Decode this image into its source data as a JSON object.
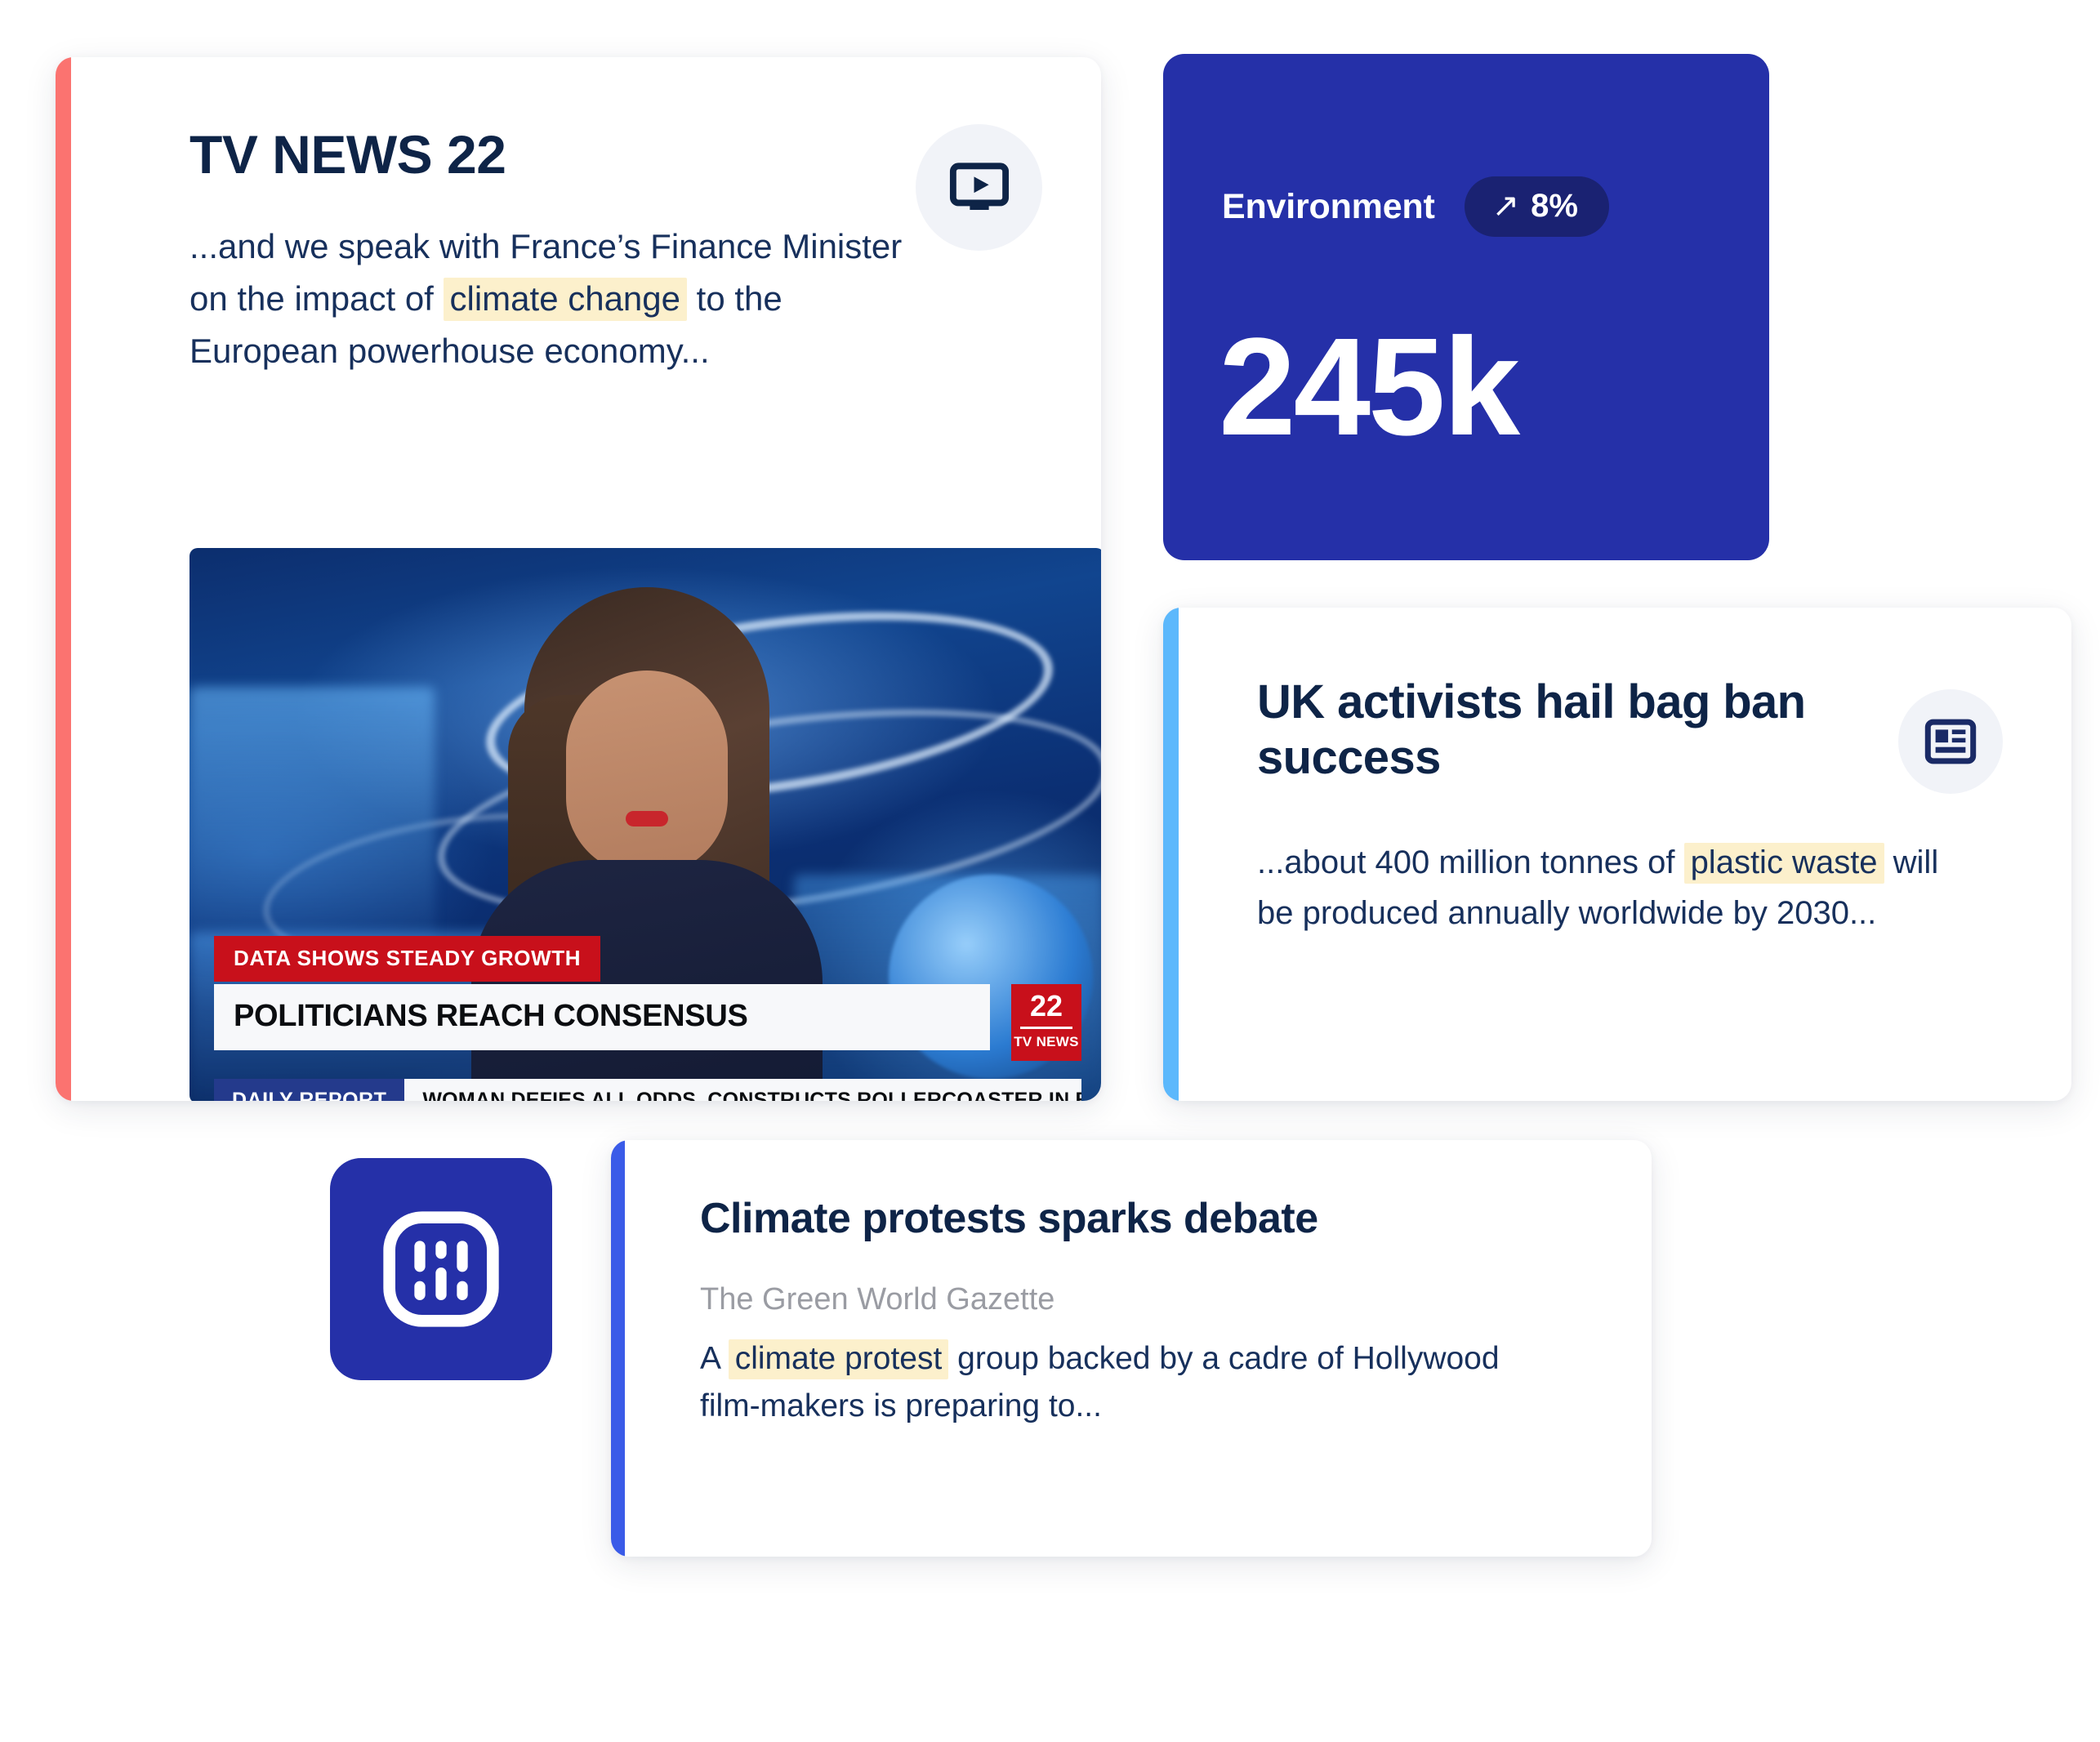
{
  "cards": {
    "tv_news": {
      "title": "TV NEWS 22",
      "snippet_part1": "...and we speak with France’s Finance Minister on the impact of ",
      "snippet_highlight": "climate change",
      "snippet_part2": " to the European powerhouse economy...",
      "icon": "tv-play-icon",
      "accent_color": "#FB7370",
      "broadcast": {
        "kicker": "DATA SHOWS STEADY GROWTH",
        "headline": "POLITICIANS REACH CONSENSUS",
        "logo_number": "22",
        "logo_caption": "TV NEWS",
        "ticker_tag": "DAILY REPORT",
        "ticker_text": "WOMAN DEFIES ALL ODDS, CONSTRUCTS ROLLERCOASTER IN BACKYARD"
      }
    },
    "stat": {
      "label": "Environment",
      "trend_arrow": "↗",
      "trend_value": "8%",
      "value": "245k",
      "background_color": "#2530A8",
      "badge_color": "#1A2272"
    },
    "uk_activists": {
      "title": "UK activists hail bag ban success",
      "snippet_part1": "...about 400 million tonnes of ",
      "snippet_highlight": "plastic waste",
      "snippet_part2": " will be produced annually worldwide by 2030...",
      "icon": "article-layout-icon",
      "accent_color": "#5CB8FC"
    },
    "climate": {
      "logo_icon": "brand-grid-logo",
      "title": "Climate protests sparks debate",
      "source": "The Green World Gazette",
      "snippet_part1": "A ",
      "snippet_highlight": "climate protest",
      "snippet_part2": " group backed by a cadre of Hollywood film-makers is preparing to...",
      "accent_color": "#3A5BE8"
    }
  },
  "theme": {
    "highlight_color": "#FCF0CC",
    "text_navy": "#0E2447",
    "body_navy": "#17305C",
    "muted_gray": "#9A9CA3"
  }
}
